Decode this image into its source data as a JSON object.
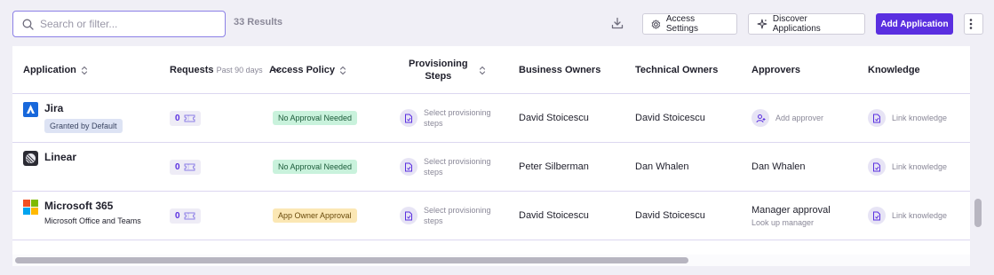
{
  "toolbar": {
    "search_placeholder": "Search or filter...",
    "results": "33 Results",
    "access_settings": "Access Settings",
    "discover_applications": "Discover Applications",
    "add_application": "Add Application"
  },
  "columns": {
    "application": "Application",
    "requests": "Requests",
    "requests_sub": "Past 90 days",
    "access_policy": "Access Policy",
    "provisioning_line1": "Provisioning",
    "provisioning_line2": "Steps",
    "business_owners": "Business Owners",
    "technical_owners": "Technical Owners",
    "approvers": "Approvers",
    "knowledge": "Knowledge"
  },
  "rows": [
    {
      "name": "Jira",
      "tag": "Granted by Default",
      "requests": "0",
      "policy": "No Approval Needed",
      "prov_line1": "Select provisioning",
      "prov_line2": "steps",
      "business_owner": "David Stoicescu",
      "technical_owner": "David Stoicescu",
      "approver_action": "Add approver",
      "knowledge": "Link knowledge"
    },
    {
      "name": "Linear",
      "requests": "0",
      "policy": "No Approval Needed",
      "prov_line1": "Select provisioning",
      "prov_line2": "steps",
      "business_owner": "Peter Silberman",
      "technical_owner": "Dan Whalen",
      "approver": "Dan Whalen",
      "knowledge": "Link knowledge"
    },
    {
      "name": "Microsoft 365",
      "subtitle": "Microsoft Office and Teams",
      "requests": "0",
      "policy": "App Owner Approval",
      "prov_line1": "Select provisioning",
      "prov_line2": "steps",
      "business_owner": "David Stoicescu",
      "technical_owner": "David Stoicescu",
      "approver": "Manager approval",
      "approver_sub": "Look up manager",
      "knowledge": "Link knowledge"
    }
  ],
  "colors": {
    "accent": "#5a2fe0",
    "green_badge": "#c9f2dc",
    "yellow_badge": "#fbe7b4",
    "jira_blue": "#1868db"
  },
  "icons": {
    "search": "search-icon",
    "download": "download-icon",
    "settings": "gear-icon",
    "discover": "sparkle-icon",
    "more": "more-vertical-icon",
    "sort": "sort-icon",
    "filter": "chevron-down-icon",
    "ticket": "ticket-icon",
    "document": "document-icon",
    "add_user": "add-user-icon"
  }
}
